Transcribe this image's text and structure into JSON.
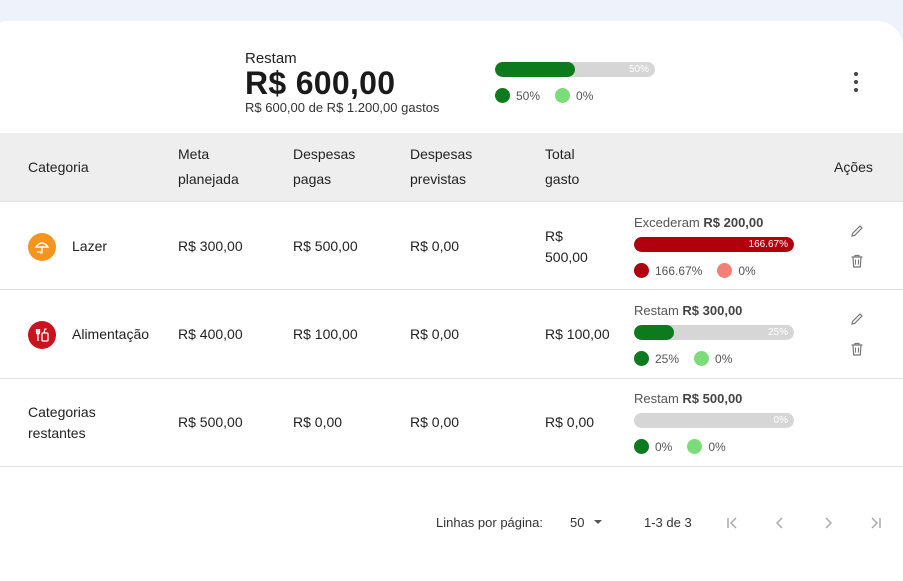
{
  "summary": {
    "label": "Restam",
    "amount": "R$ 600,00",
    "subtitle": "R$ 600,00 de R$ 1.200,00 gastos",
    "progress": 0.5,
    "progress_label": "50%",
    "legend": [
      {
        "text": "50%",
        "color": "#0e7a1e"
      },
      {
        "text": "0%",
        "color": "#7ddc7a"
      }
    ]
  },
  "table": {
    "headers": {
      "categoria": "Categoria",
      "meta_1": "Meta",
      "meta_2": "planejada",
      "pagas_1": "Despesas",
      "pagas_2": "pagas",
      "previstas_1": "Despesas",
      "previstas_2": "previstas",
      "total_1": "Total",
      "total_2": "gasto",
      "acoes": "Ações"
    },
    "rows": [
      {
        "category": "Lazer",
        "icon": "umbrella-icon",
        "icon_color": "#f7941d",
        "meta": "R$ 300,00",
        "pagas": "R$ 500,00",
        "previstas": "R$ 0,00",
        "total_1": "R$",
        "total_2": "500,00",
        "status_prefix": "Excederam",
        "status_amount": "R$ 200,00",
        "progress": 1.0,
        "progress_label": "166.67%",
        "bar_color": "#b00010",
        "legend": [
          {
            "text": "166.67%",
            "color": "#b00010"
          },
          {
            "text": "0%",
            "color": "#f28074"
          }
        ]
      },
      {
        "category": "Alimentação",
        "icon": "food-icon",
        "icon_color": "#c8141e",
        "meta": "R$ 400,00",
        "pagas": "R$ 100,00",
        "previstas": "R$ 0,00",
        "total": "R$ 100,00",
        "status_prefix": "Restam",
        "status_amount": "R$ 300,00",
        "progress": 0.25,
        "progress_label": "25%",
        "bar_color": "#0e7a1e",
        "legend": [
          {
            "text": "25%",
            "color": "#0e7a1e"
          },
          {
            "text": "0%",
            "color": "#7ddc7a"
          }
        ]
      },
      {
        "category_1": "Categorias",
        "category_2": "restantes",
        "meta": "R$ 500,00",
        "pagas": "R$ 0,00",
        "previstas": "R$ 0,00",
        "total": "R$ 0,00",
        "status_prefix": "Restam",
        "status_amount": "R$ 500,00",
        "progress": 0,
        "progress_label": "0%",
        "bar_color": "#0e7a1e",
        "legend": [
          {
            "text": "0%",
            "color": "#0e7a1e"
          },
          {
            "text": "0%",
            "color": "#7ddc7a"
          }
        ]
      }
    ]
  },
  "pagination": {
    "rows_label": "Linhas por página:",
    "rows_value": "50",
    "range": "1-3 de 3"
  }
}
